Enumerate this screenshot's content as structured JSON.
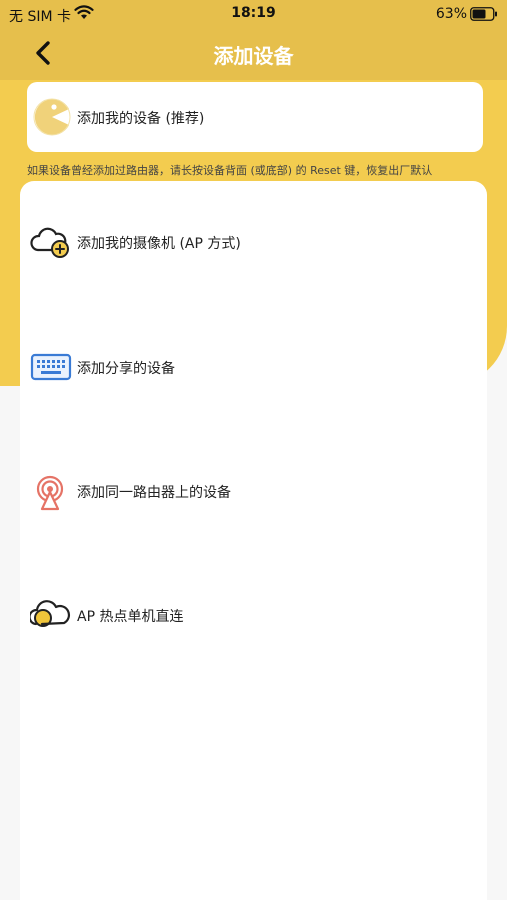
{
  "status_bar": {
    "carrier": "无 SIM 卡",
    "time": "18:19",
    "battery": "63%"
  },
  "nav": {
    "title": "添加设备"
  },
  "recommend": {
    "label": "添加我的设备 (推荐)"
  },
  "hint": "如果设备曾经添加过路由器，请长按设备背面 (或底部) 的 Reset 键，恢复出厂默认",
  "options": [
    {
      "label": "添加我的摄像机 (AP 方式)",
      "icon": "cloud-plus-icon"
    },
    {
      "label": "添加分享的设备",
      "icon": "keyboard-icon"
    },
    {
      "label": "添加同一路由器上的设备",
      "icon": "router-signal-icon"
    },
    {
      "label": "AP 热点单机直连",
      "icon": "cloud-hotspot-icon"
    }
  ],
  "colors": {
    "accent_yellow": "#f3cc4f",
    "header_yellow": "#e6bf4c",
    "icon_blue": "#3a7bd5",
    "icon_red": "#e57366"
  }
}
